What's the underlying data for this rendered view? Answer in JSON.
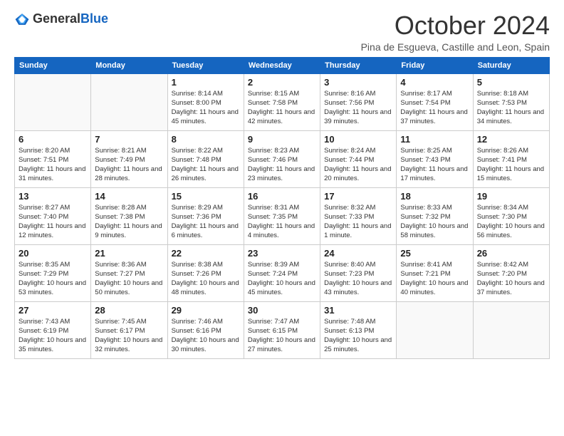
{
  "logo": {
    "general": "General",
    "blue": "Blue"
  },
  "header": {
    "title": "October 2024",
    "subtitle": "Pina de Esgueva, Castille and Leon, Spain"
  },
  "weekdays": [
    "Sunday",
    "Monday",
    "Tuesday",
    "Wednesday",
    "Thursday",
    "Friday",
    "Saturday"
  ],
  "weeks": [
    [
      {
        "day": "",
        "info": ""
      },
      {
        "day": "",
        "info": ""
      },
      {
        "day": "1",
        "info": "Sunrise: 8:14 AM\nSunset: 8:00 PM\nDaylight: 11 hours and 45 minutes."
      },
      {
        "day": "2",
        "info": "Sunrise: 8:15 AM\nSunset: 7:58 PM\nDaylight: 11 hours and 42 minutes."
      },
      {
        "day": "3",
        "info": "Sunrise: 8:16 AM\nSunset: 7:56 PM\nDaylight: 11 hours and 39 minutes."
      },
      {
        "day": "4",
        "info": "Sunrise: 8:17 AM\nSunset: 7:54 PM\nDaylight: 11 hours and 37 minutes."
      },
      {
        "day": "5",
        "info": "Sunrise: 8:18 AM\nSunset: 7:53 PM\nDaylight: 11 hours and 34 minutes."
      }
    ],
    [
      {
        "day": "6",
        "info": "Sunrise: 8:20 AM\nSunset: 7:51 PM\nDaylight: 11 hours and 31 minutes."
      },
      {
        "day": "7",
        "info": "Sunrise: 8:21 AM\nSunset: 7:49 PM\nDaylight: 11 hours and 28 minutes."
      },
      {
        "day": "8",
        "info": "Sunrise: 8:22 AM\nSunset: 7:48 PM\nDaylight: 11 hours and 26 minutes."
      },
      {
        "day": "9",
        "info": "Sunrise: 8:23 AM\nSunset: 7:46 PM\nDaylight: 11 hours and 23 minutes."
      },
      {
        "day": "10",
        "info": "Sunrise: 8:24 AM\nSunset: 7:44 PM\nDaylight: 11 hours and 20 minutes."
      },
      {
        "day": "11",
        "info": "Sunrise: 8:25 AM\nSunset: 7:43 PM\nDaylight: 11 hours and 17 minutes."
      },
      {
        "day": "12",
        "info": "Sunrise: 8:26 AM\nSunset: 7:41 PM\nDaylight: 11 hours and 15 minutes."
      }
    ],
    [
      {
        "day": "13",
        "info": "Sunrise: 8:27 AM\nSunset: 7:40 PM\nDaylight: 11 hours and 12 minutes."
      },
      {
        "day": "14",
        "info": "Sunrise: 8:28 AM\nSunset: 7:38 PM\nDaylight: 11 hours and 9 minutes."
      },
      {
        "day": "15",
        "info": "Sunrise: 8:29 AM\nSunset: 7:36 PM\nDaylight: 11 hours and 6 minutes."
      },
      {
        "day": "16",
        "info": "Sunrise: 8:31 AM\nSunset: 7:35 PM\nDaylight: 11 hours and 4 minutes."
      },
      {
        "day": "17",
        "info": "Sunrise: 8:32 AM\nSunset: 7:33 PM\nDaylight: 11 hours and 1 minute."
      },
      {
        "day": "18",
        "info": "Sunrise: 8:33 AM\nSunset: 7:32 PM\nDaylight: 10 hours and 58 minutes."
      },
      {
        "day": "19",
        "info": "Sunrise: 8:34 AM\nSunset: 7:30 PM\nDaylight: 10 hours and 56 minutes."
      }
    ],
    [
      {
        "day": "20",
        "info": "Sunrise: 8:35 AM\nSunset: 7:29 PM\nDaylight: 10 hours and 53 minutes."
      },
      {
        "day": "21",
        "info": "Sunrise: 8:36 AM\nSunset: 7:27 PM\nDaylight: 10 hours and 50 minutes."
      },
      {
        "day": "22",
        "info": "Sunrise: 8:38 AM\nSunset: 7:26 PM\nDaylight: 10 hours and 48 minutes."
      },
      {
        "day": "23",
        "info": "Sunrise: 8:39 AM\nSunset: 7:24 PM\nDaylight: 10 hours and 45 minutes."
      },
      {
        "day": "24",
        "info": "Sunrise: 8:40 AM\nSunset: 7:23 PM\nDaylight: 10 hours and 43 minutes."
      },
      {
        "day": "25",
        "info": "Sunrise: 8:41 AM\nSunset: 7:21 PM\nDaylight: 10 hours and 40 minutes."
      },
      {
        "day": "26",
        "info": "Sunrise: 8:42 AM\nSunset: 7:20 PM\nDaylight: 10 hours and 37 minutes."
      }
    ],
    [
      {
        "day": "27",
        "info": "Sunrise: 7:43 AM\nSunset: 6:19 PM\nDaylight: 10 hours and 35 minutes."
      },
      {
        "day": "28",
        "info": "Sunrise: 7:45 AM\nSunset: 6:17 PM\nDaylight: 10 hours and 32 minutes."
      },
      {
        "day": "29",
        "info": "Sunrise: 7:46 AM\nSunset: 6:16 PM\nDaylight: 10 hours and 30 minutes."
      },
      {
        "day": "30",
        "info": "Sunrise: 7:47 AM\nSunset: 6:15 PM\nDaylight: 10 hours and 27 minutes."
      },
      {
        "day": "31",
        "info": "Sunrise: 7:48 AM\nSunset: 6:13 PM\nDaylight: 10 hours and 25 minutes."
      },
      {
        "day": "",
        "info": ""
      },
      {
        "day": "",
        "info": ""
      }
    ]
  ]
}
